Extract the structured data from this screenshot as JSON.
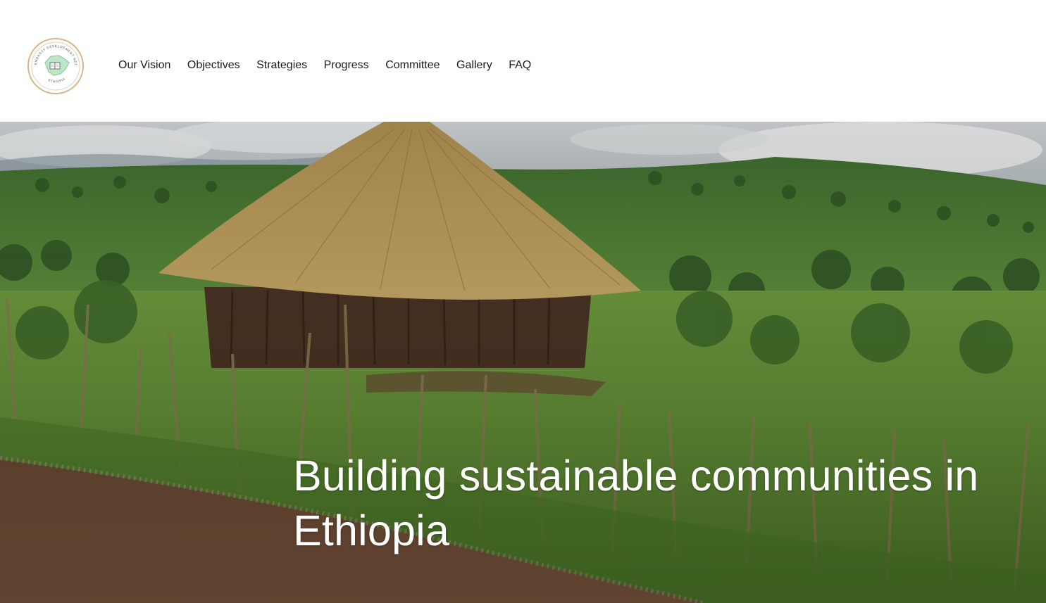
{
  "header": {
    "logo_name": "seal-logo",
    "logo_text_top": "EMBASSY DEVELOPMENT NETWORK",
    "logo_text_bottom": "ETHIOPIA"
  },
  "nav": {
    "items": [
      {
        "label": "Our Vision"
      },
      {
        "label": "Objectives"
      },
      {
        "label": "Strategies"
      },
      {
        "label": "Progress"
      },
      {
        "label": "Committee"
      },
      {
        "label": "Gallery"
      },
      {
        "label": "FAQ"
      }
    ]
  },
  "hero": {
    "title": "Building sustainable communities in Ethiopia",
    "image_alt_icon": "thatched-hut-landscape-image"
  },
  "colors": {
    "nav_text": "#1a1a1a",
    "hero_text": "#ffffff",
    "logo_ring": "#d9b38c",
    "logo_map": "#8ccf9a"
  }
}
